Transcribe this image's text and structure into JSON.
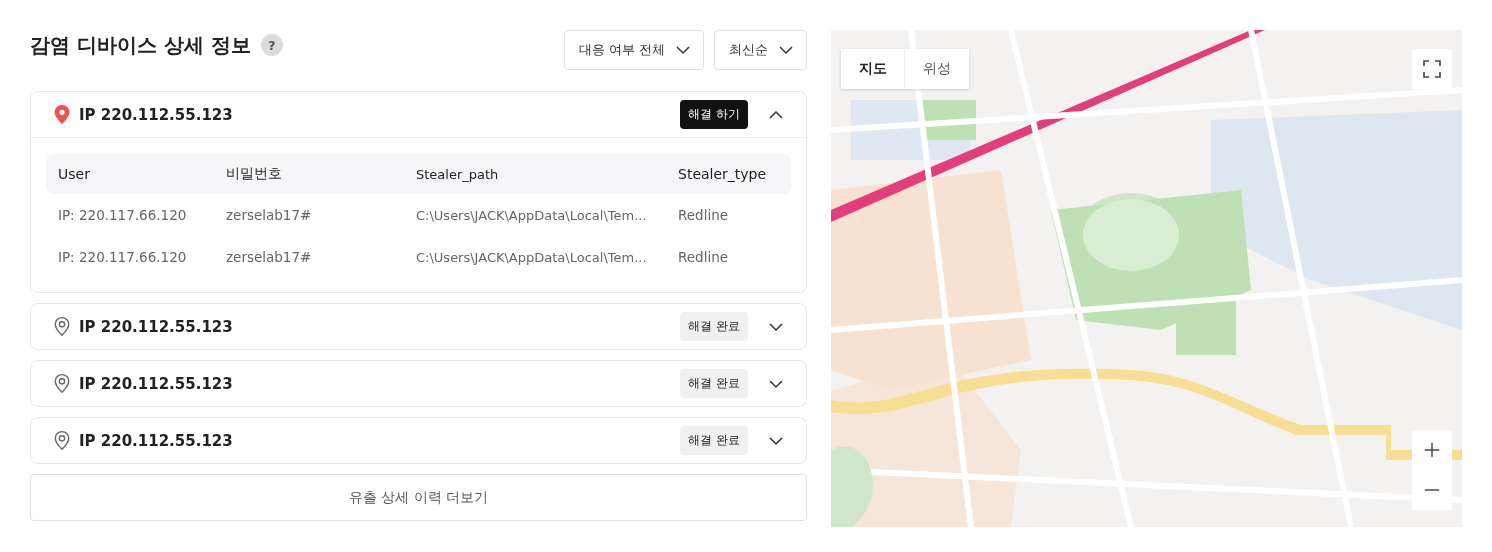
{
  "header": {
    "title": "감염 디바이스 상세 정보",
    "help": "?"
  },
  "filters": [
    {
      "label": "대응 여부 전체"
    },
    {
      "label": "최신순"
    }
  ],
  "devices": [
    {
      "ip": "IP 220.112.55.123",
      "expanded": true,
      "resolved": false,
      "action": "해결 하기",
      "table": {
        "columns": [
          "User",
          "비밀번호",
          "Stealer_path",
          "Stealer_type"
        ],
        "rows": [
          [
            "IP: 220.117.66.120",
            "zerselab17#",
            "C:\\Users\\JACK\\AppData\\Local\\Tem...",
            "Redline"
          ],
          [
            "IP: 220.117.66.120",
            "zerselab17#",
            "C:\\Users\\JACK\\AppData\\Local\\Tem...",
            "Redline"
          ]
        ]
      }
    },
    {
      "ip": "IP 220.112.55.123",
      "expanded": false,
      "resolved": true,
      "action": "해결 완료"
    },
    {
      "ip": "IP 220.112.55.123",
      "expanded": false,
      "resolved": true,
      "action": "해결 완료"
    },
    {
      "ip": "IP 220.112.55.123",
      "expanded": false,
      "resolved": true,
      "action": "해결 완료"
    }
  ],
  "more_button": "유출 상세 이력 더보기",
  "map": {
    "tabs": [
      {
        "label": "지도",
        "selected": true
      },
      {
        "label": "위성",
        "selected": false
      }
    ]
  }
}
